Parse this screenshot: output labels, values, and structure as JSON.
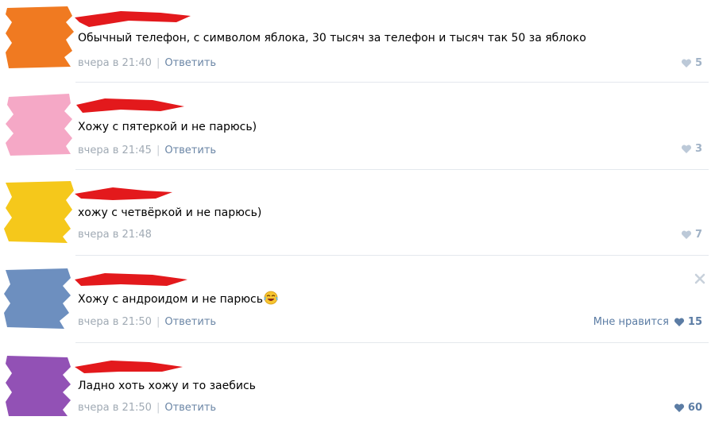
{
  "colors": {
    "avatars": [
      "#f07a21",
      "#f5a8c6",
      "#f5c81b",
      "#6d8fbf",
      "#9251b5"
    ],
    "scribble": "#e3191c",
    "link": "#6b86a6",
    "meta": "#a0aab4"
  },
  "comments": [
    {
      "text": "Обычный телефон, с символом яблока, 30 тысяч за телефон и тысяч так 50 за яблоко",
      "time": "вчера в 21:40",
      "reply": "Ответить",
      "likes": "5",
      "liked": false
    },
    {
      "text": "Хожу с пятеркой и не парюсь)",
      "time": "вчера в 21:45",
      "reply": "Ответить",
      "likes": "3",
      "liked": false
    },
    {
      "text": "хожу с четвёркой и не парюсь)",
      "time": "вчера в 21:48",
      "reply": "",
      "likes": "7",
      "liked": false
    },
    {
      "text": "Хожу с андроидом и не парюсь",
      "emoji": "laughing-emoji",
      "time": "вчера в 21:50",
      "reply": "Ответить",
      "like_label": "Мне нравится",
      "likes": "15",
      "liked": true
    },
    {
      "text": "Ладно хоть хожу и то заебись",
      "time": "вчера в 21:50",
      "reply": "Ответить",
      "likes": "60",
      "liked": true
    }
  ],
  "icons": {
    "like": "heart-icon",
    "close": "close-icon"
  }
}
